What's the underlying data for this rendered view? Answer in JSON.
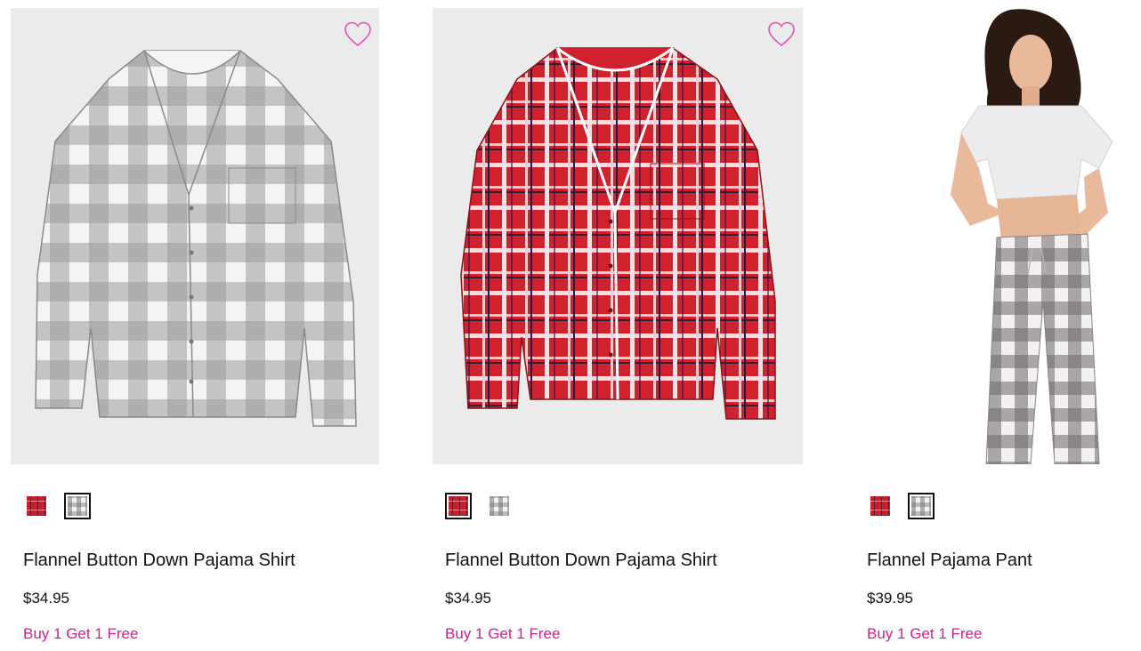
{
  "products": [
    {
      "title": "Flannel Button Down Pajama Shirt",
      "price": "$34.95",
      "promo": "Buy 1 Get 1 Free",
      "image": "grey-white buffalo check flannel button-down shirt",
      "wishlist_icon": "heart-outline-icon",
      "swatches": [
        {
          "color": "red-plaid",
          "selected": false
        },
        {
          "color": "grey-check",
          "selected": true
        }
      ]
    },
    {
      "title": "Flannel Button Down Pajama Shirt",
      "price": "$34.95",
      "promo": "Buy 1 Get 1 Free",
      "image": "red plaid flannel button-down shirt with white piping",
      "wishlist_icon": "heart-outline-icon",
      "swatches": [
        {
          "color": "red-plaid",
          "selected": true
        },
        {
          "color": "grey-check",
          "selected": false
        }
      ]
    },
    {
      "title": "Flannel Pajama Pant",
      "price": "$39.95",
      "promo": "Buy 1 Get 1 Free",
      "image": "model wearing white tee and grey-white check flannel pajama pants",
      "swatches": [
        {
          "color": "red-plaid",
          "selected": false
        },
        {
          "color": "grey-check",
          "selected": true
        }
      ]
    }
  ],
  "colors": {
    "accent": "#d0208e",
    "wishlist": "#e84fb8",
    "text": "#111111",
    "image_bg": "#ebebeb"
  }
}
